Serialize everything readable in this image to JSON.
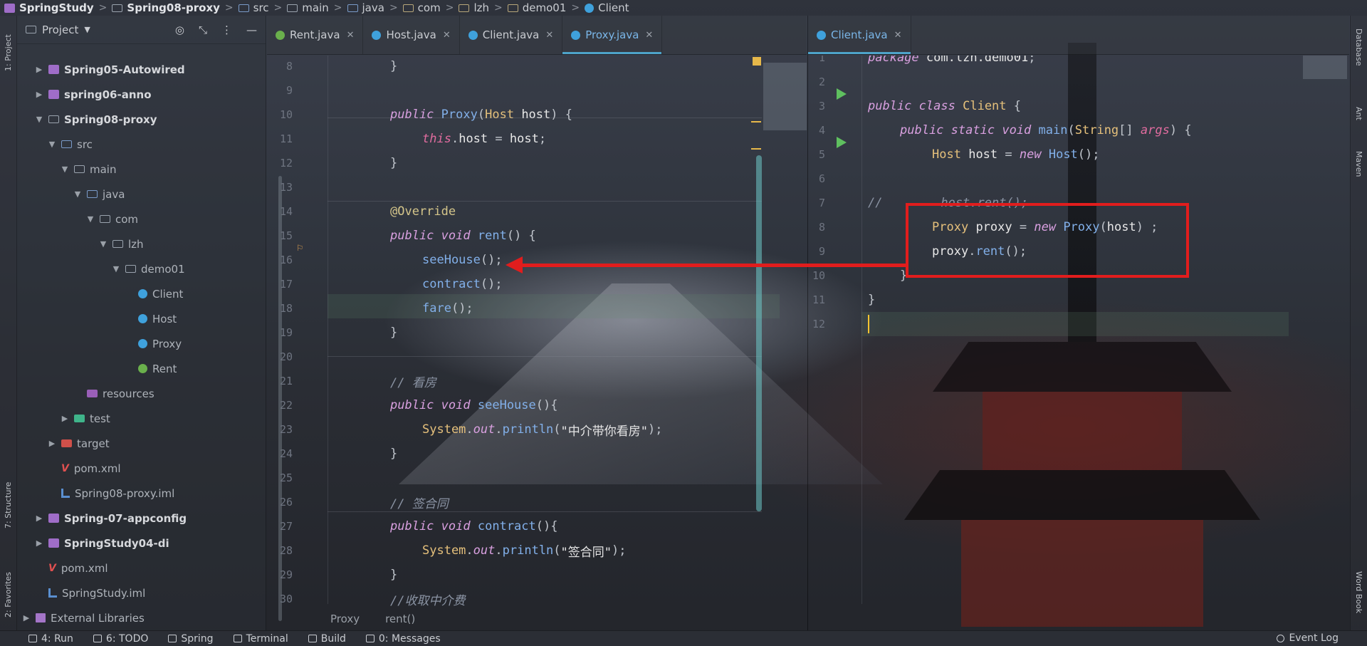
{
  "breadcrumb": [
    "SpringStudy",
    "Spring08-proxy",
    "src",
    "main",
    "java",
    "com",
    "lzh",
    "demo01",
    "Client"
  ],
  "left_strip": {
    "project_label": "1: Project",
    "structure_label": "7: Structure",
    "favorites_label": "2: Favorites"
  },
  "right_strip": {
    "database_label": "Database",
    "ant_label": "Ant",
    "maven_label": "Maven",
    "wordbook_label": "Word Book"
  },
  "project_panel": {
    "title": "Project",
    "tree": [
      {
        "label": "Spring05-Autowired",
        "depth": 1,
        "arrow": "▶",
        "icon": "module",
        "bold": true
      },
      {
        "label": "spring06-anno",
        "depth": 1,
        "arrow": "▶",
        "icon": "module",
        "bold": true
      },
      {
        "label": "Spring08-proxy",
        "depth": 1,
        "arrow": "▼",
        "icon": "folder",
        "bold": true
      },
      {
        "label": "src",
        "depth": 2,
        "arrow": "▼",
        "icon": "src"
      },
      {
        "label": "main",
        "depth": 3,
        "arrow": "▼",
        "icon": "folder"
      },
      {
        "label": "java",
        "depth": 4,
        "arrow": "▼",
        "icon": "folder-blue"
      },
      {
        "label": "com",
        "depth": 5,
        "arrow": "▼",
        "icon": "folder"
      },
      {
        "label": "lzh",
        "depth": 6,
        "arrow": "▼",
        "icon": "folder"
      },
      {
        "label": "demo01",
        "depth": 7,
        "arrow": "▼",
        "icon": "folder"
      },
      {
        "label": "Client",
        "depth": 8,
        "arrow": "",
        "icon": "class"
      },
      {
        "label": "Host",
        "depth": 8,
        "arrow": "",
        "icon": "class"
      },
      {
        "label": "Proxy",
        "depth": 8,
        "arrow": "",
        "icon": "class"
      },
      {
        "label": "Rent",
        "depth": 8,
        "arrow": "",
        "icon": "interface"
      },
      {
        "label": "resources",
        "depth": 4,
        "arrow": "",
        "icon": "resources"
      },
      {
        "label": "test",
        "depth": 3,
        "arrow": "▶",
        "icon": "folder-green"
      },
      {
        "label": "target",
        "depth": 2,
        "arrow": "▶",
        "icon": "folder-red"
      },
      {
        "label": "pom.xml",
        "depth": 2,
        "arrow": "",
        "icon": "maven"
      },
      {
        "label": "Spring08-proxy.iml",
        "depth": 2,
        "arrow": "",
        "icon": "iml"
      },
      {
        "label": "Spring-07-appconfig",
        "depth": 1,
        "arrow": "▶",
        "icon": "module",
        "bold": true
      },
      {
        "label": "SpringStudy04-di",
        "depth": 1,
        "arrow": "▶",
        "icon": "module",
        "bold": true
      },
      {
        "label": "pom.xml",
        "depth": 1,
        "arrow": "",
        "icon": "maven"
      },
      {
        "label": "SpringStudy.iml",
        "depth": 1,
        "arrow": "",
        "icon": "iml"
      },
      {
        "label": "External Libraries",
        "depth": 0,
        "arrow": "▶",
        "icon": "library"
      }
    ]
  },
  "left_editor": {
    "tabs": [
      {
        "label": "Rent.java",
        "icon": "interface",
        "active": false
      },
      {
        "label": "Host.java",
        "icon": "class",
        "active": false
      },
      {
        "label": "Client.java",
        "icon": "class",
        "active": false
      },
      {
        "label": "Proxy.java",
        "icon": "class",
        "active": true
      }
    ],
    "footer_breadcrumb": [
      "Proxy",
      "rent()"
    ],
    "lines": [
      {
        "n": "7",
        "indent": 1,
        "tokens": [
          [
            "kw",
            "public"
          ],
          [
            "pc",
            " "
          ],
          [
            "fn",
            "Proxy"
          ],
          [
            "pc",
            "() {"
          ]
        ]
      },
      {
        "n": "8",
        "indent": 1,
        "tokens": [
          [
            "pc",
            "}"
          ]
        ]
      },
      {
        "n": "9",
        "indent": 0,
        "tokens": []
      },
      {
        "n": "10",
        "indent": 1,
        "tokens": [
          [
            "kw",
            "public"
          ],
          [
            "pc",
            " "
          ],
          [
            "fn",
            "Proxy"
          ],
          [
            "pc",
            "("
          ],
          [
            "cls",
            "Host"
          ],
          [
            "pc",
            " "
          ],
          [
            "id",
            "host"
          ],
          [
            "pc",
            ") {"
          ]
        ]
      },
      {
        "n": "11",
        "indent": 2,
        "tokens": [
          [
            "kw2",
            "this"
          ],
          [
            "pc",
            "."
          ],
          [
            "id",
            "host"
          ],
          [
            "pc",
            " = "
          ],
          [
            "id",
            "host"
          ],
          [
            "pc",
            ";"
          ]
        ]
      },
      {
        "n": "12",
        "indent": 1,
        "tokens": [
          [
            "pc",
            "}"
          ]
        ]
      },
      {
        "n": "13",
        "indent": 0,
        "tokens": []
      },
      {
        "n": "14",
        "indent": 1,
        "tokens": [
          [
            "anno",
            "@Override"
          ]
        ]
      },
      {
        "n": "15",
        "indent": 1,
        "tokens": [
          [
            "kw",
            "public"
          ],
          [
            "pc",
            " "
          ],
          [
            "kw",
            "void"
          ],
          [
            "pc",
            " "
          ],
          [
            "fn",
            "rent"
          ],
          [
            "pc",
            "() {"
          ]
        ]
      },
      {
        "n": "16",
        "indent": 2,
        "tokens": [
          [
            "fn",
            "seeHouse"
          ],
          [
            "pc",
            "();"
          ]
        ]
      },
      {
        "n": "17",
        "indent": 2,
        "tokens": [
          [
            "fn",
            "contract"
          ],
          [
            "pc",
            "();"
          ]
        ]
      },
      {
        "n": "18",
        "indent": 2,
        "tokens": [
          [
            "fn",
            "fare"
          ],
          [
            "pc",
            "();"
          ]
        ]
      },
      {
        "n": "19",
        "indent": 1,
        "tokens": [
          [
            "pc",
            "}"
          ]
        ]
      },
      {
        "n": "20",
        "indent": 0,
        "tokens": []
      },
      {
        "n": "21",
        "indent": 1,
        "tokens": [
          [
            "cmt",
            "// 看房"
          ]
        ]
      },
      {
        "n": "22",
        "indent": 1,
        "tokens": [
          [
            "kw",
            "public"
          ],
          [
            "pc",
            " "
          ],
          [
            "kw",
            "void"
          ],
          [
            "pc",
            " "
          ],
          [
            "fn",
            "seeHouse"
          ],
          [
            "pc",
            "(){"
          ]
        ]
      },
      {
        "n": "23",
        "indent": 2,
        "tokens": [
          [
            "cls",
            "System"
          ],
          [
            "pc",
            "."
          ],
          [
            "kw",
            "out"
          ],
          [
            "pc",
            "."
          ],
          [
            "fn",
            "println"
          ],
          [
            "pc",
            "("
          ],
          [
            "str",
            "\"中介带你看房\""
          ],
          [
            "pc",
            ");"
          ]
        ]
      },
      {
        "n": "24",
        "indent": 1,
        "tokens": [
          [
            "pc",
            "}"
          ]
        ]
      },
      {
        "n": "25",
        "indent": 0,
        "tokens": []
      },
      {
        "n": "26",
        "indent": 1,
        "tokens": [
          [
            "cmt",
            "// 签合同"
          ]
        ]
      },
      {
        "n": "27",
        "indent": 1,
        "tokens": [
          [
            "kw",
            "public"
          ],
          [
            "pc",
            " "
          ],
          [
            "kw",
            "void"
          ],
          [
            "pc",
            " "
          ],
          [
            "fn",
            "contract"
          ],
          [
            "pc",
            "(){"
          ]
        ]
      },
      {
        "n": "28",
        "indent": 2,
        "tokens": [
          [
            "cls",
            "System"
          ],
          [
            "pc",
            "."
          ],
          [
            "kw",
            "out"
          ],
          [
            "pc",
            "."
          ],
          [
            "fn",
            "println"
          ],
          [
            "pc",
            "("
          ],
          [
            "str",
            "\"签合同\""
          ],
          [
            "pc",
            ");"
          ]
        ]
      },
      {
        "n": "29",
        "indent": 1,
        "tokens": [
          [
            "pc",
            "}"
          ]
        ]
      },
      {
        "n": "30",
        "indent": 1,
        "tokens": [
          [
            "cmt",
            "//收取中介费"
          ]
        ]
      }
    ]
  },
  "right_editor": {
    "tabs": [
      {
        "label": "Client.java",
        "icon": "class",
        "active": true
      }
    ],
    "lines": [
      {
        "n": "1",
        "indent": 0,
        "tokens": [
          [
            "kw",
            "package"
          ],
          [
            "pc",
            " "
          ],
          [
            "id",
            "com.lzh.demo01"
          ],
          [
            "pc",
            ";"
          ]
        ]
      },
      {
        "n": "2",
        "indent": 0,
        "tokens": []
      },
      {
        "n": "3",
        "indent": 0,
        "tokens": [
          [
            "kw",
            "public"
          ],
          [
            "pc",
            " "
          ],
          [
            "kw",
            "class"
          ],
          [
            "pc",
            " "
          ],
          [
            "cls",
            "Client"
          ],
          [
            "pc",
            " {"
          ]
        ]
      },
      {
        "n": "4",
        "indent": 1,
        "tokens": [
          [
            "kw",
            "public"
          ],
          [
            "pc",
            " "
          ],
          [
            "kw",
            "static"
          ],
          [
            "pc",
            " "
          ],
          [
            "kw",
            "void"
          ],
          [
            "pc",
            " "
          ],
          [
            "fn",
            "main"
          ],
          [
            "pc",
            "("
          ],
          [
            "cls",
            "String"
          ],
          [
            "pc",
            "[] "
          ],
          [
            "kw2",
            "args"
          ],
          [
            "pc",
            ") {"
          ]
        ]
      },
      {
        "n": "5",
        "indent": 2,
        "tokens": [
          [
            "cls",
            "Host"
          ],
          [
            "pc",
            " "
          ],
          [
            "id",
            "host"
          ],
          [
            "pc",
            " = "
          ],
          [
            "kw",
            "new"
          ],
          [
            "pc",
            " "
          ],
          [
            "fn",
            "Host"
          ],
          [
            "pc",
            "();"
          ]
        ]
      },
      {
        "n": "6",
        "indent": 0,
        "tokens": []
      },
      {
        "n": "7",
        "indent": 0,
        "tokens": [
          [
            "cmt",
            "//        host.rent();"
          ]
        ]
      },
      {
        "n": "8",
        "indent": 2,
        "tokens": [
          [
            "cls",
            "Proxy"
          ],
          [
            "pc",
            " "
          ],
          [
            "id",
            "proxy"
          ],
          [
            "pc",
            " = "
          ],
          [
            "kw",
            "new"
          ],
          [
            "pc",
            " "
          ],
          [
            "fn",
            "Proxy"
          ],
          [
            "pc",
            "("
          ],
          [
            "id",
            "host"
          ],
          [
            "pc",
            ") ;"
          ]
        ]
      },
      {
        "n": "9",
        "indent": 2,
        "tokens": [
          [
            "id",
            "proxy"
          ],
          [
            "pc",
            "."
          ],
          [
            "fn",
            "rent"
          ],
          [
            "pc",
            "();"
          ]
        ]
      },
      {
        "n": "10",
        "indent": 1,
        "tokens": [
          [
            "pc",
            "}"
          ]
        ]
      },
      {
        "n": "11",
        "indent": 0,
        "tokens": [
          [
            "pc",
            "}"
          ]
        ]
      },
      {
        "n": "12",
        "indent": 0,
        "tokens": []
      }
    ]
  },
  "bottom_bar": {
    "items": [
      {
        "label": "4: Run",
        "icon": "run-icon"
      },
      {
        "label": "6: TODO",
        "icon": "todo-icon"
      },
      {
        "label": "Spring",
        "icon": "spring-icon"
      },
      {
        "label": "Terminal",
        "icon": "terminal-icon"
      },
      {
        "label": "Build",
        "icon": "build-icon"
      },
      {
        "label": "0: Messages",
        "icon": "messages-icon"
      }
    ],
    "event_log": "Event Log"
  },
  "colors": {
    "accent": "#4ea3c9",
    "annotation_red": "#e11d1d",
    "run_green": "#5fc05f",
    "caret": "#f4c430"
  }
}
